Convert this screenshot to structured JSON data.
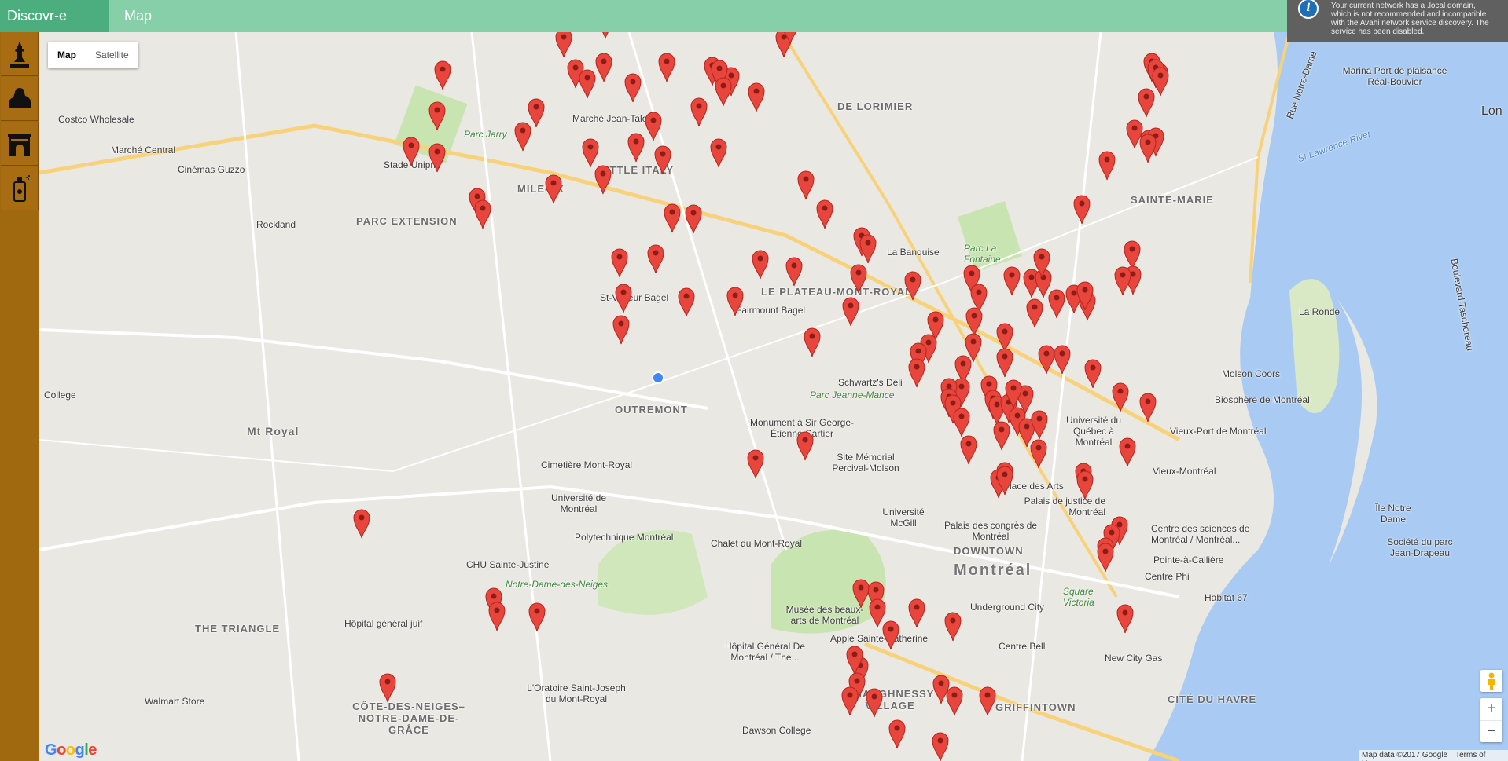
{
  "app": {
    "brand": "Discovr-e",
    "tab_map": "Map"
  },
  "sidebar": {
    "categories": [
      {
        "name": "statue-category",
        "icon": "statue-icon"
      },
      {
        "name": "sphinx-category",
        "icon": "sphinx-icon"
      },
      {
        "name": "monument-category",
        "icon": "arch-icon"
      },
      {
        "name": "spray-can-category",
        "icon": "spray-can-icon"
      }
    ]
  },
  "map_type": {
    "map": "Map",
    "satellite": "Satellite",
    "selected": "Map"
  },
  "notice": "Your current network has a .local domain, which is not recommended and incompatible with the Avahi network service discovery. The service has been disabled.",
  "zoom": {
    "in": "+",
    "out": "−"
  },
  "attribution": {
    "data": "Map data ©2017 Google",
    "terms": "Terms of Use"
  },
  "google_logo": "Google",
  "colors": {
    "marker": "#e8453c",
    "water": "#a9cbf3",
    "park": "#c2e3a9",
    "topbar": "#86cfa8",
    "brand_bg": "#4cae7f",
    "sidebar": "#a0680f"
  },
  "labels": {
    "costco": "Costco Wholesale",
    "marche_central": "Marché Central",
    "cinemas_guzzo": "Cinémas Guzzo",
    "parc_jarry": "Parc Jarry",
    "stade_uniprix": "Stade Uniprix",
    "marche_jean_talon": "Marché Jean-Talon",
    "mile_ex": "MILE-EX",
    "little_italy": "LITTLE ITALY",
    "parc_extension": "PARC EXTENSION",
    "rockland": "Rockland",
    "de_lorimier": "DE LORIMIER",
    "sainte_marie": "SAINTE-MARIE",
    "la_banquise": "La Banquise",
    "parc_la_fontaine": "Parc La Fontaine",
    "le_plateau": "LE PLATEAU-MONT-ROYAL",
    "st_viateur": "St-Viateur Bagel",
    "fairmount": "Fairmount Bagel",
    "outremont": "OUTREMONT",
    "schwartz": "Schwartz's Deli",
    "parc_jeanne_mance": "Parc Jeanne-Mance",
    "monument_cartier": "Monument à Sir George-Étienne Cartier",
    "mt_royal": "Mt Royal",
    "college": "College",
    "cimetiere": "Cimetière Mont-Royal",
    "site_memorial": "Site Mémorial Percival-Molson",
    "universite_montreal": "Université de Montréal",
    "polytechnique": "Polytechnique Montréal",
    "chalet": "Chalet du Mont-Royal",
    "chu": "CHU Sainte-Justine",
    "notre_dame_neiges": "Notre-Dame-des-Neiges",
    "mcgill": "Université McGill",
    "place_des_arts": "Place des Arts",
    "palais_justice": "Palais de justice de Montréal",
    "palais_congres": "Palais des congrès de Montréal",
    "downtown": "DOWNTOWN",
    "montreal": "Montréal",
    "square_victoria": "Square Victoria",
    "uqam": "Université du Québec à Montréal",
    "molson": "Molson Coors",
    "biosphere": "Biosphère de Montréal",
    "vieux_port": "Vieux-Port de Montréal",
    "vieux_montreal": "Vieux-Montréal",
    "la_ronde": "La Ronde",
    "marina": "Marina Port de plaisance Réal-Bouvier",
    "ile_notre_dame": "Île Notre Dame",
    "centre_sciences": "Centre des sciences de Montréal / Montréal...",
    "pointe_calliere": "Pointe-à-Callière",
    "centre_phi": "Centre Phi",
    "habitat67": "Habitat 67",
    "societe_parc": "Société du parc Jean-Drapeau",
    "new_city_gas": "New City Gas",
    "cite_du_havre": "CITÉ DU HAVRE",
    "griffintown": "GRIFFINTOWN",
    "centre_bell": "Centre Bell",
    "underground_city": "Underground City",
    "musee_beaux_arts": "Musée des beaux-arts de Montréal",
    "apple_ste_catherine": "Apple Sainte-Catherine",
    "shaughnessy": "SHAUGHNESSY VILLAGE",
    "dawson": "Dawson College",
    "hopital_general": "Hôpital Général De Montréal / The...",
    "oratoire": "L'Oratoire Saint-Joseph du Mont-Royal",
    "hopital_juif": "Hôpital général juif",
    "the_triangle": "THE TRIANGLE",
    "cote_des_neiges": "CÔTE-DES-NEIGES– NOTRE-DAME-DE-GRÂCE",
    "walmart": "Walmart Store",
    "st_lawrence_river": "St Lawrence River",
    "lon": "Lon",
    "boulevard_taschereau": "Boulevard Taschereau",
    "rue_notre_dame": "Rue Notre-Dame"
  },
  "markers": [
    [
      717,
      72
    ],
    [
      770,
      48
    ],
    [
      732,
      111
    ],
    [
      747,
      124
    ],
    [
      768,
      103
    ],
    [
      805,
      129
    ],
    [
      848,
      103
    ],
    [
      906,
      108
    ],
    [
      930,
      121
    ],
    [
      915,
      112
    ],
    [
      920,
      134
    ],
    [
      962,
      141
    ],
    [
      997,
      72
    ],
    [
      1005,
      55
    ],
    [
      563,
      113
    ],
    [
      556,
      165
    ],
    [
      523,
      210
    ],
    [
      556,
      218
    ],
    [
      682,
      161
    ],
    [
      665,
      191
    ],
    [
      889,
      160
    ],
    [
      831,
      178
    ],
    [
      809,
      205
    ],
    [
      751,
      212
    ],
    [
      843,
      221
    ],
    [
      914,
      212
    ],
    [
      704,
      258
    ],
    [
      767,
      246
    ],
    [
      607,
      275
    ],
    [
      614,
      290
    ],
    [
      855,
      295
    ],
    [
      882,
      296
    ],
    [
      1025,
      253
    ],
    [
      1049,
      290
    ],
    [
      1010,
      363
    ],
    [
      967,
      354
    ],
    [
      1092,
      372
    ],
    [
      1082,
      414
    ],
    [
      1033,
      453
    ],
    [
      1096,
      325
    ],
    [
      1104,
      334
    ],
    [
      1161,
      381
    ],
    [
      1190,
      432
    ],
    [
      1181,
      461
    ],
    [
      1168,
      472
    ],
    [
      1166,
      492
    ],
    [
      1024,
      585
    ],
    [
      961,
      608
    ],
    [
      834,
      347
    ],
    [
      788,
      352
    ],
    [
      793,
      397
    ],
    [
      790,
      437
    ],
    [
      873,
      402
    ],
    [
      935,
      401
    ],
    [
      1236,
      373
    ],
    [
      1245,
      397
    ],
    [
      1239,
      427
    ],
    [
      1287,
      375
    ],
    [
      1312,
      378
    ],
    [
      1327,
      378
    ],
    [
      1316,
      416
    ],
    [
      1238,
      460
    ],
    [
      1278,
      447
    ],
    [
      1278,
      479
    ],
    [
      1225,
      488
    ],
    [
      1223,
      517
    ],
    [
      1325,
      352
    ],
    [
      1344,
      404
    ],
    [
      1366,
      398
    ],
    [
      1383,
      407
    ],
    [
      1380,
      394
    ],
    [
      1390,
      493
    ],
    [
      1331,
      475
    ],
    [
      1351,
      475
    ],
    [
      1207,
      517
    ],
    [
      1207,
      530
    ],
    [
      1212,
      538
    ],
    [
      1223,
      555
    ],
    [
      1258,
      514
    ],
    [
      1263,
      532
    ],
    [
      1268,
      540
    ],
    [
      1283,
      537
    ],
    [
      1304,
      526
    ],
    [
      1294,
      554
    ],
    [
      1306,
      568
    ],
    [
      1322,
      558
    ],
    [
      1321,
      595
    ],
    [
      1274,
      572
    ],
    [
      1289,
      519
    ],
    [
      1278,
      624
    ],
    [
      1270,
      633
    ],
    [
      1278,
      629
    ],
    [
      1232,
      590
    ],
    [
      1425,
      523
    ],
    [
      1460,
      536
    ],
    [
      1434,
      593
    ],
    [
      1378,
      625
    ],
    [
      1380,
      635
    ],
    [
      1424,
      693
    ],
    [
      1414,
      703
    ],
    [
      1406,
      720
    ],
    [
      1406,
      727
    ],
    [
      1431,
      805
    ],
    [
      1376,
      284
    ],
    [
      1440,
      342
    ],
    [
      1441,
      374
    ],
    [
      1428,
      375
    ],
    [
      1461,
      201
    ],
    [
      1475,
      116
    ],
    [
      1465,
      103
    ],
    [
      1470,
      111
    ],
    [
      1476,
      121
    ],
    [
      1458,
      148
    ],
    [
      1443,
      188
    ],
    [
      1470,
      198
    ],
    [
      1460,
      206
    ],
    [
      1408,
      228
    ],
    [
      460,
      684
    ],
    [
      493,
      893
    ],
    [
      628,
      784
    ],
    [
      632,
      802
    ],
    [
      683,
      803
    ],
    [
      1094,
      872
    ],
    [
      1087,
      858
    ],
    [
      1090,
      892
    ],
    [
      1081,
      910
    ],
    [
      1112,
      912
    ],
    [
      1114,
      776
    ],
    [
      1095,
      773
    ],
    [
      1116,
      798
    ],
    [
      1133,
      826
    ],
    [
      1166,
      798
    ],
    [
      1197,
      895
    ],
    [
      1212,
      815
    ],
    [
      1196,
      968
    ],
    [
      1141,
      952
    ],
    [
      1256,
      910
    ],
    [
      1214,
      910
    ]
  ]
}
